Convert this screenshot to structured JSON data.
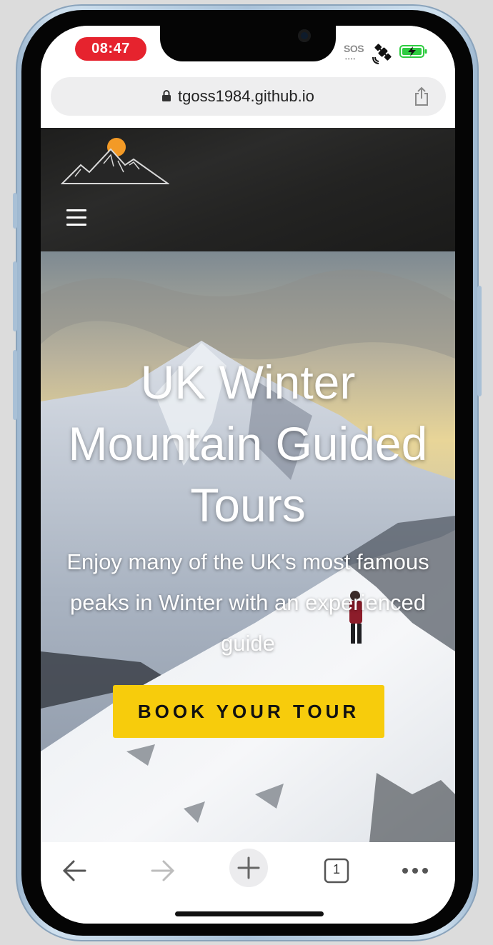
{
  "status": {
    "time": "08:47",
    "sos": "SOS",
    "sos_dots": "••••",
    "satellite_icon": "satellite-icon",
    "battery_icon": "battery-charging-icon",
    "battery_color": "#2ecc40"
  },
  "browser": {
    "url": "tgoss1984.github.io",
    "lock_icon": "lock-icon",
    "share_icon": "share-icon",
    "toolbar": {
      "back_icon": "back-arrow-icon",
      "forward_icon": "forward-arrow-icon",
      "new_tab_icon": "plus-icon",
      "tab_count": "1",
      "more_icon": "more-dots-icon"
    }
  },
  "site": {
    "logo_icon": "mountain-sun-logo-icon",
    "menu_icon": "hamburger-menu-icon",
    "hero": {
      "title": "UK Winter Mountain Guided Tours",
      "subtitle": "Enjoy many of the UK's most famous peaks in Winter with an experienced guide",
      "cta_label": "BOOK YOUR TOUR",
      "cta_color": "#f7cc0c"
    }
  }
}
